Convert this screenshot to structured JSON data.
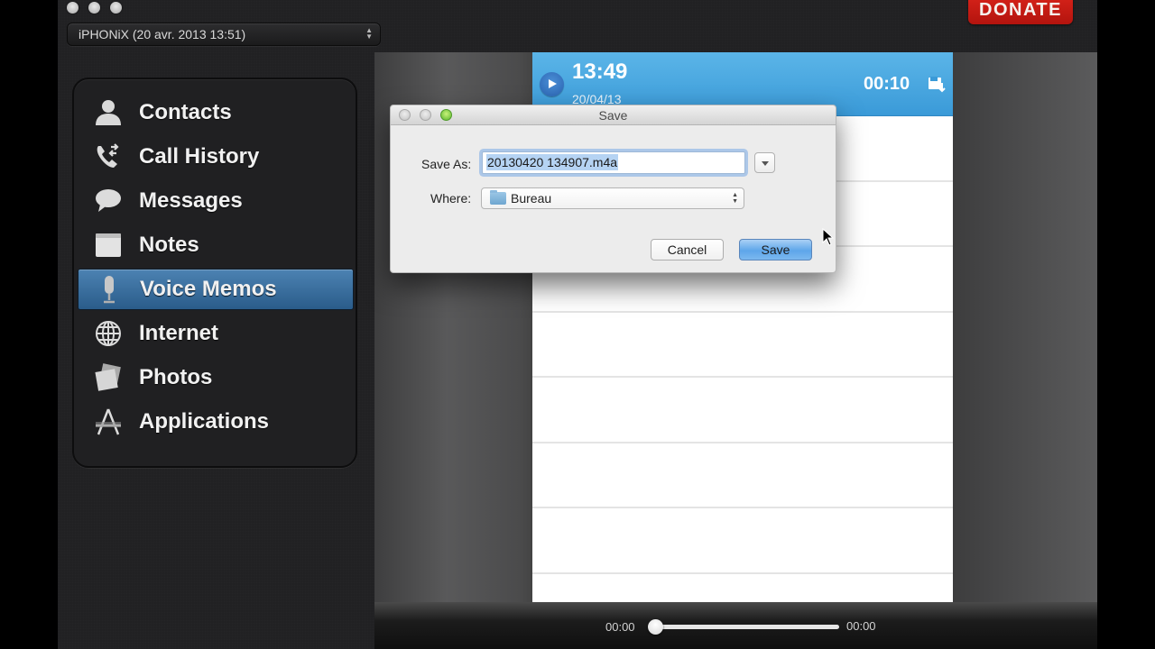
{
  "window": {
    "device_select": {
      "value": "iPHONiX (20 avr. 2013 13:51)",
      "icon": "updown-arrows-icon"
    },
    "donate_label": "DONATE"
  },
  "sidebar": {
    "items": [
      {
        "label": "Contacts",
        "icon": "contact-person-icon",
        "active": false
      },
      {
        "label": "Call History",
        "icon": "phone-call-icon",
        "active": false
      },
      {
        "label": "Messages",
        "icon": "speech-bubble-icon",
        "active": false
      },
      {
        "label": "Notes",
        "icon": "notepad-icon",
        "active": false
      },
      {
        "label": "Voice Memos",
        "icon": "microphone-icon",
        "active": true
      },
      {
        "label": "Internet",
        "icon": "globe-icon",
        "active": false
      },
      {
        "label": "Photos",
        "icon": "photos-icon",
        "active": false
      },
      {
        "label": "Applications",
        "icon": "app-store-icon",
        "active": false
      }
    ]
  },
  "memo": {
    "time": "13:49",
    "date": "20/04/13",
    "duration": "00:10",
    "accent_color": "#3f9ed9"
  },
  "player": {
    "elapsed": "00:00",
    "total": "00:00",
    "progress": 0
  },
  "dialog": {
    "title": "Save",
    "save_as_label": "Save As:",
    "save_as_value": "20130420 134907.m4a",
    "where_label": "Where:",
    "where_value": "Bureau",
    "cancel_label": "Cancel",
    "save_label": "Save"
  }
}
